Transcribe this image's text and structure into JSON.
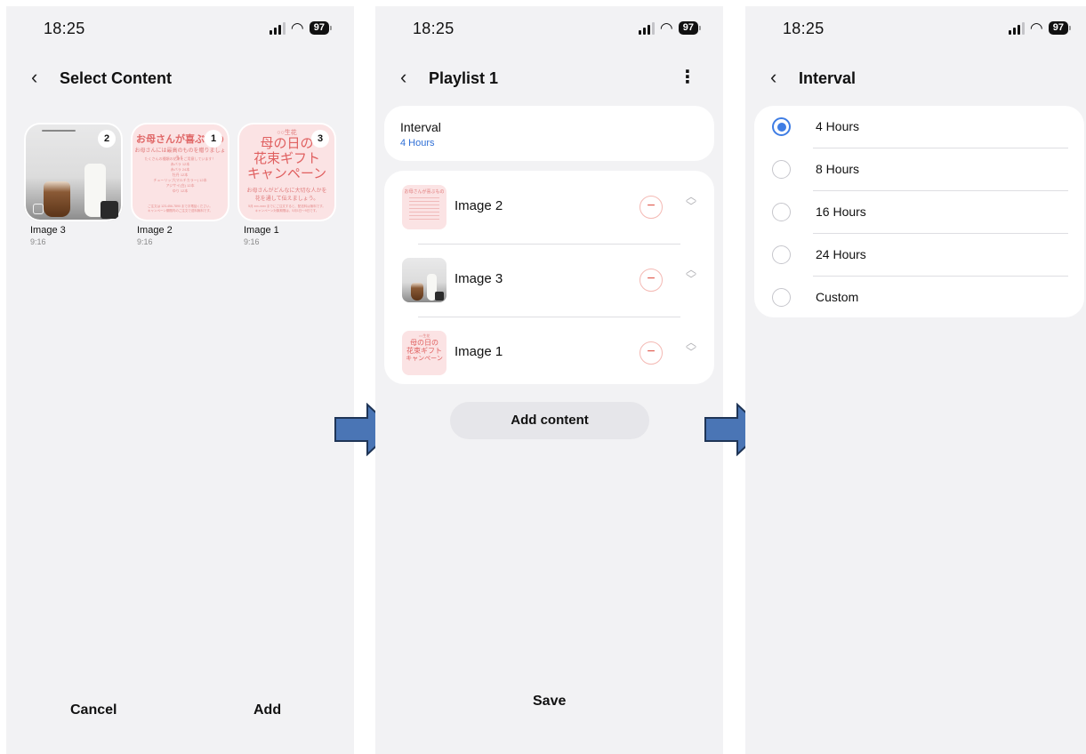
{
  "status_bar": {
    "time": "18:25",
    "battery": "97"
  },
  "screen1": {
    "title": "Select Content",
    "items": [
      {
        "name": "Image 3",
        "ratio": "9:16",
        "badge": "2"
      },
      {
        "name": "Image 2",
        "ratio": "9:16",
        "badge": "1"
      },
      {
        "name": "Image 1",
        "ratio": "9:16",
        "badge": "3"
      }
    ],
    "image2_art": {
      "headline": "お母さんが喜ぶもの",
      "sub": "お母さんには最高のものを贈りましょう！",
      "lines": [
        "たくさんの種類の花束をご用意しています！",
        "赤バラ 12本",
        "赤バラ 24本",
        "牡丹 12本",
        "チューリップ(マルチカラー) 12本",
        "アジサイ(白) 12本",
        "ゆり 12本"
      ],
      "footer": [
        "ご注文は 123-456-7890 までお電話ください。",
        "キャンペーン期間内のご注文で送料無料です。"
      ]
    },
    "image1_art": {
      "tag": "○○生花",
      "headline1": "母の日の",
      "headline2": "花束ギフト",
      "headline3": "キャンペーン",
      "sub1": "お母さんがどんなに大切な人かを",
      "sub2": "花を通して伝えましょう。",
      "fine1": "5月 xxx-xxxx までにご注文すると、配送料は無料です。",
      "fine2": "キャンペーン対象期間は、5月1日〜9日です。"
    },
    "cancel": "Cancel",
    "add": "Add"
  },
  "screen2": {
    "title": "Playlist 1",
    "more_icon": "⋮",
    "interval_label": "Interval",
    "interval_value": "4 Hours",
    "rows": [
      {
        "name": "Image 2"
      },
      {
        "name": "Image 3"
      },
      {
        "name": "Image 1"
      }
    ],
    "add_content": "Add content",
    "save": "Save"
  },
  "screen3": {
    "title": "Interval",
    "options": [
      {
        "label": "4 Hours",
        "selected": true
      },
      {
        "label": "8 Hours",
        "selected": false
      },
      {
        "label": "16 Hours",
        "selected": false
      },
      {
        "label": "24 Hours",
        "selected": false
      },
      {
        "label": "Custom",
        "selected": false
      }
    ]
  },
  "colors": {
    "accent": "#3f7de4",
    "link": "#2f6fd6",
    "danger": "#e05a4f",
    "arrow": "#4a75b5",
    "background": "#f2f2f4"
  },
  "icons": {
    "back": "chevron-left-icon",
    "more": "more-vertical-icon",
    "minus": "remove-icon",
    "reorder": "reorder-icon",
    "wifi": "wifi-icon",
    "signal": "signal-icon"
  }
}
